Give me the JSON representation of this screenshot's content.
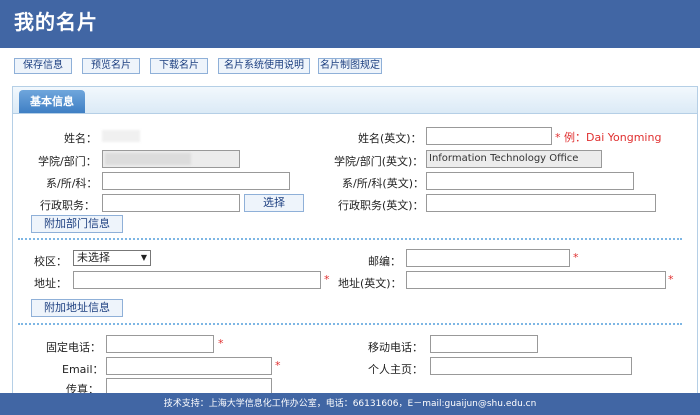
{
  "page_title": "我的名片",
  "toolbar": {
    "buttons": [
      "保存信息",
      "预览名片",
      "下载名片",
      "名片系统使用说明",
      "名片制图规定"
    ]
  },
  "panel": {
    "tab_label": "基本信息"
  },
  "basic": {
    "name_label": "姓名：",
    "name_en_label": "姓名(英文)：",
    "name_en_hint": "* 例：Dai Yongming",
    "dept_label": "学院/部门：",
    "dept_en_label": "学院/部门(英文)：",
    "dept_en_value": "Information Technology Office",
    "faculty_label": "系/所/科：",
    "faculty_en_label": "系/所/科(英文)：",
    "position_label": "行政职务：",
    "position_en_label": "行政职务(英文)：",
    "select_button": "选择",
    "add_dept_button": "附加部门信息"
  },
  "address": {
    "campus_label": "校区：",
    "campus_value": "未选择",
    "postcode_label": "邮编：",
    "address_label": "地址：",
    "address_en_label": "地址(英文)：",
    "add_address_button": "附加地址信息"
  },
  "contact": {
    "phone_label": "固定电话：",
    "mobile_label": "移动电话：",
    "email_label": "Email：",
    "homepage_label": "个人主页：",
    "fax_label": "传真："
  },
  "required_mark": "*",
  "footer": {
    "text": "技术支持：上海大学信息化工作办公室，电话：66131606，E－mail:guaijun@shu.edu.cn"
  },
  "colors": {
    "header_bg": "#4166a4",
    "required": "#e03030",
    "accent": "#3f7fc4"
  }
}
